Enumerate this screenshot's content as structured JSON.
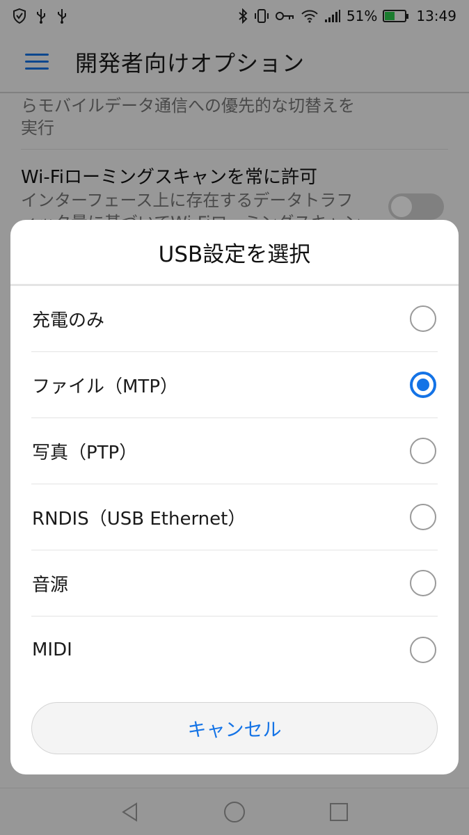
{
  "status_bar": {
    "left_icons": [
      "shield-icon",
      "usb-icon",
      "usb-icon"
    ],
    "battery_percent": "51%",
    "battery_level": 0.51,
    "time": "13:49"
  },
  "app_bar": {
    "title": "開発者向けオプション"
  },
  "background": {
    "item1_desc": "らモバイルデータ通信への優先的な切替えを実行",
    "item2_title": "Wi-Fiローミングスキャンを常に許可",
    "item2_desc": "インターフェース上に存在するデータトラフィック量に基づいてWi-Fiローミングスキャン",
    "item2_toggle_on": false
  },
  "dialog": {
    "title": "USB設定を選択",
    "options": [
      {
        "label": "充電のみ",
        "selected": false
      },
      {
        "label": "ファイル（MTP）",
        "selected": true
      },
      {
        "label": "写真（PTP）",
        "selected": false
      },
      {
        "label": "RNDIS（USB Ethernet）",
        "selected": false
      },
      {
        "label": "音源",
        "selected": false
      },
      {
        "label": "MIDI",
        "selected": false
      }
    ],
    "cancel_label": "キャンセル"
  },
  "colors": {
    "accent": "#1473e6",
    "battery": "#2dc84d"
  }
}
